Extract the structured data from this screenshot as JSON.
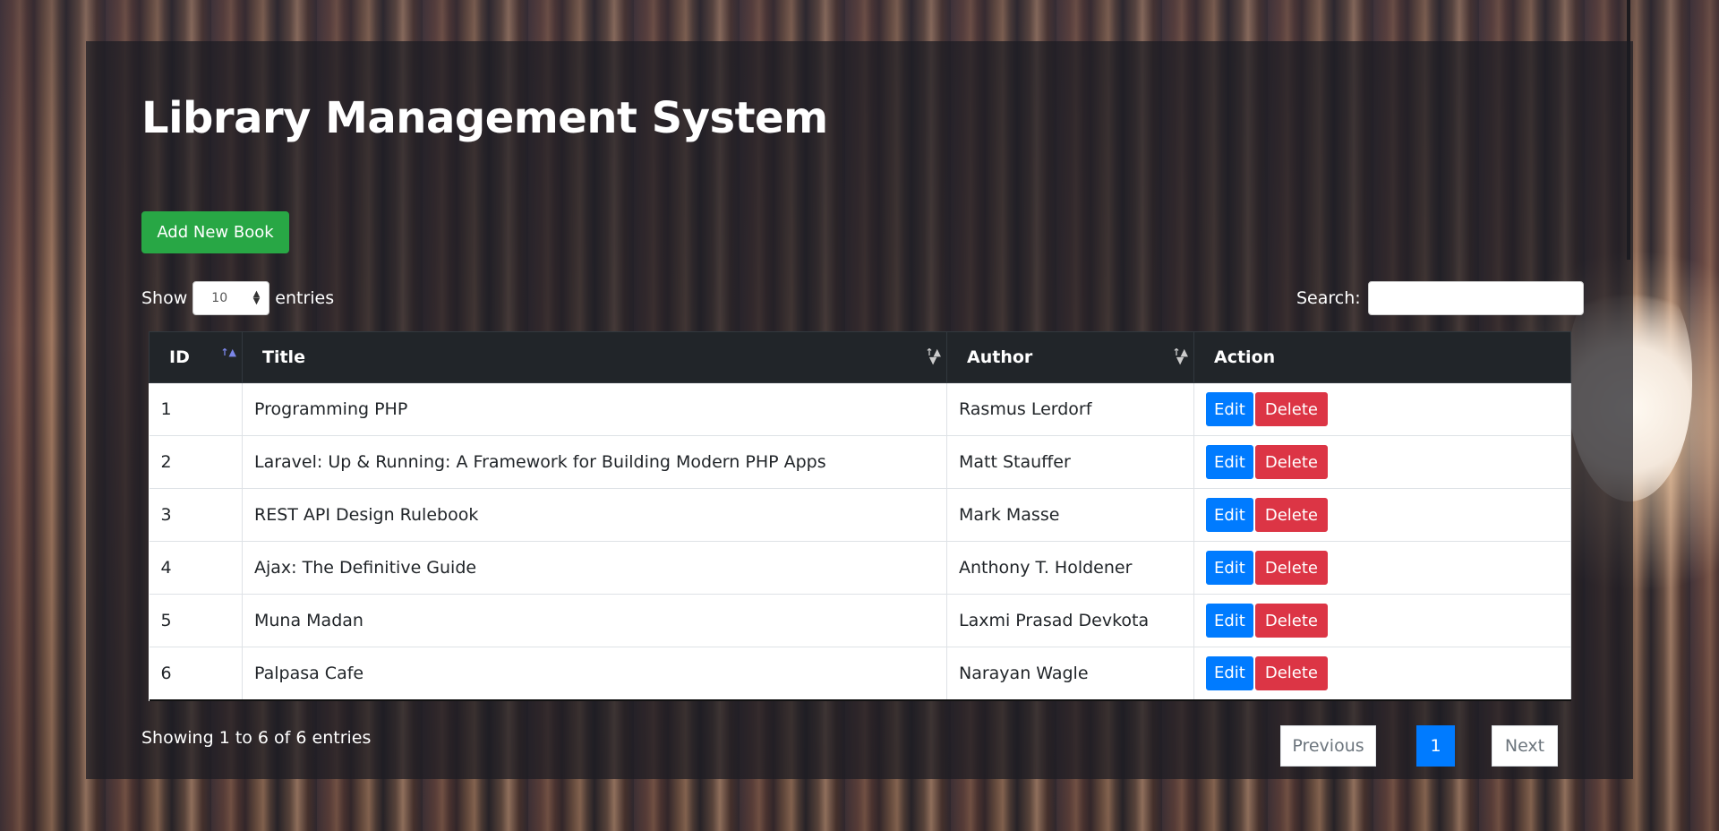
{
  "header": {
    "title": "Library Management System"
  },
  "toolbar": {
    "add_label": "Add New Book"
  },
  "length": {
    "prefix": "Show",
    "value": "10",
    "suffix": "entries"
  },
  "search": {
    "label": "Search:",
    "value": ""
  },
  "table": {
    "headers": [
      "ID",
      "Title",
      "Author",
      "Action"
    ],
    "rows": [
      {
        "id": "1",
        "title": "Programming PHP",
        "author": "Rasmus Lerdorf"
      },
      {
        "id": "2",
        "title": "Laravel: Up & Running: A Framework for Building Modern PHP Apps",
        "author": "Matt Stauffer"
      },
      {
        "id": "3",
        "title": "REST API Design Rulebook",
        "author": "Mark Masse"
      },
      {
        "id": "4",
        "title": "Ajax: The Definitive Guide",
        "author": "Anthony T. Holdener"
      },
      {
        "id": "5",
        "title": "Muna Madan",
        "author": "Laxmi Prasad Devkota"
      },
      {
        "id": "6",
        "title": "Palpasa Cafe",
        "author": "Narayan Wagle"
      }
    ],
    "edit_label": "Edit",
    "delete_label": "Delete"
  },
  "info": "Showing 1 to 6 of 6 entries",
  "pagination": {
    "previous": "Previous",
    "current": "1",
    "next": "Next"
  },
  "colors": {
    "add": "#28a745",
    "edit": "#007bff",
    "delete": "#dc3545",
    "header_bg": "#212529"
  }
}
